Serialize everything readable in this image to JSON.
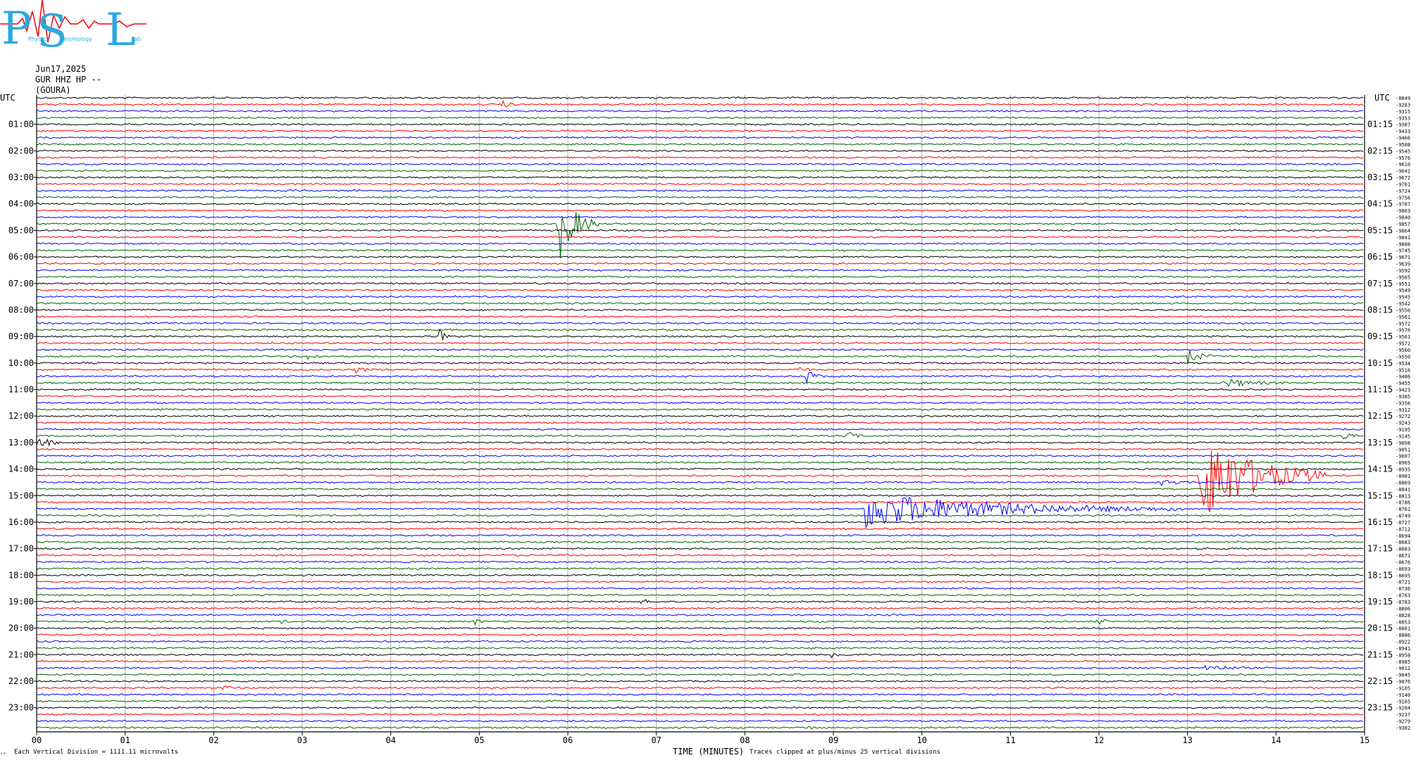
{
  "logo": {
    "big_letters": [
      "P",
      "S",
      "L"
    ],
    "small_words": [
      "Physics",
      "eismology",
      "ab"
    ]
  },
  "header": {
    "date": "Jun17,2025",
    "station": "GUR HHZ HP --",
    "site": "(GOURA)"
  },
  "footer": {
    "mark": "ᵥₐ",
    "left": "Each Vertical Division = 1111.11 microvolts",
    "center": "TIME (MINUTES)",
    "right": "Traces clipped at plus/minus 25 vertical divisions"
  },
  "chart_data": {
    "type": "line",
    "title": "",
    "xlabel": "TIME (MINUTES)",
    "ylabel": "",
    "x_range": [
      0,
      15
    ],
    "x_ticks": [
      "00",
      "01",
      "02",
      "03",
      "04",
      "05",
      "06",
      "07",
      "08",
      "09",
      "10",
      "11",
      "12",
      "13",
      "14",
      "15"
    ],
    "left_axis_title": "UTC",
    "right_axis_title": "UTC",
    "left_labels": [
      "01:00",
      "02:00",
      "03:00",
      "04:00",
      "05:00",
      "06:00",
      "07:00",
      "08:00",
      "09:00",
      "10:00",
      "11:00",
      "12:00",
      "13:00",
      "14:00",
      "15:00",
      "16:00",
      "17:00",
      "18:00",
      "19:00",
      "20:00",
      "21:00",
      "22:00",
      "23:00"
    ],
    "right_labels": [
      "01:15",
      "02:15",
      "03:15",
      "04:15",
      "05:15",
      "06:15",
      "07:15",
      "08:15",
      "09:15",
      "10:15",
      "11:15",
      "12:15",
      "13:15",
      "14:15",
      "15:15",
      "16:15",
      "17:15",
      "18:15",
      "19:15",
      "20:15",
      "21:15",
      "22:15",
      "23:15"
    ],
    "trace_colors": [
      "#000000",
      "#ff0000",
      "#0000ff",
      "#006400"
    ],
    "trace_count": 96,
    "grid": true,
    "trace_offsets": [
      "-8849",
      "-9283",
      "-9315",
      "-9353",
      "-9387",
      "-9433",
      "-9466",
      "-9508",
      "-9545",
      "-9576",
      "-9610",
      "-9642",
      "-9672",
      "-9701",
      "-9724",
      "-9756",
      "-9787",
      "-9803",
      "-9840",
      "-9857",
      "-9864",
      "-9841",
      "-9808",
      "-9745",
      "-9671",
      "-9639",
      "-9592",
      "-9565",
      "-9551",
      "-9549",
      "-9545",
      "-9542",
      "-9556",
      "-9561",
      "-9572",
      "-9576",
      "-9561",
      "-9572",
      "-9560",
      "-9550",
      "-9534",
      "-9516",
      "-9486",
      "-9455",
      "-9423",
      "-9385",
      "-9356",
      "-9312",
      "-9272",
      "-9243",
      "-9195",
      "-9145",
      "-9098",
      "-9051",
      "-9007",
      "-8965",
      "-8935",
      "-8901",
      "-8869",
      "-8841",
      "-8813",
      "-8786",
      "-8761",
      "-8749",
      "-8727",
      "-8712",
      "-8694",
      "-8683",
      "-8683",
      "-8671",
      "-8676",
      "-8693",
      "-8695",
      "-8721",
      "-8736",
      "-8763",
      "-8783",
      "-8806",
      "-8828",
      "-8853",
      "-8801",
      "-8886",
      "-8922",
      "-8941",
      "-8958",
      "-8985",
      "-9012",
      "-9045",
      "-9076",
      "-9105",
      "-9140",
      "-9165",
      "-9204",
      "-9237",
      "-9279",
      "-9302"
    ],
    "events": [
      {
        "trace": 1,
        "minute": 5.25,
        "amp": 6,
        "dur": 0.35
      },
      {
        "trace": 19,
        "minute": 5.9,
        "amp": 55,
        "dur": 0.45
      },
      {
        "trace": 36,
        "minute": 4.55,
        "amp": 12,
        "dur": 0.15
      },
      {
        "trace": 39,
        "minute": 3.05,
        "amp": 6,
        "dur": 0.35
      },
      {
        "trace": 39,
        "minute": 13.0,
        "amp": 12,
        "dur": 0.4
      },
      {
        "trace": 41,
        "minute": 3.6,
        "amp": 5,
        "dur": 0.45
      },
      {
        "trace": 41,
        "minute": 8.6,
        "amp": 6,
        "dur": 0.3
      },
      {
        "trace": 42,
        "minute": 8.7,
        "amp": 10,
        "dur": 0.3
      },
      {
        "trace": 43,
        "minute": 13.4,
        "amp": 7,
        "dur": 1.1
      },
      {
        "trace": 52,
        "minute": 0.0,
        "amp": 9,
        "dur": 0.5
      },
      {
        "trace": 51,
        "minute": 9.15,
        "amp": 8,
        "dur": 0.3
      },
      {
        "trace": 51,
        "minute": 14.75,
        "amp": 8,
        "dur": 0.25
      },
      {
        "trace": 57,
        "minute": 13.15,
        "amp": 75,
        "dur": 1.4
      },
      {
        "trace": 58,
        "minute": 12.7,
        "amp": 5,
        "dur": 0.7
      },
      {
        "trace": 62,
        "minute": 9.35,
        "amp": 28,
        "dur": 3.6
      },
      {
        "trace": 76,
        "minute": 6.85,
        "amp": 8,
        "dur": 0.1
      },
      {
        "trace": 79,
        "minute": 2.75,
        "amp": 9,
        "dur": 0.1
      },
      {
        "trace": 79,
        "minute": 4.95,
        "amp": 7,
        "dur": 0.15
      },
      {
        "trace": 79,
        "minute": 12.0,
        "amp": 7,
        "dur": 0.2
      },
      {
        "trace": 84,
        "minute": 8.95,
        "amp": 7,
        "dur": 0.35
      },
      {
        "trace": 86,
        "minute": 13.2,
        "amp": 5,
        "dur": 1.0
      },
      {
        "trace": 89,
        "minute": 2.1,
        "amp": 4,
        "dur": 0.5
      },
      {
        "trace": 95,
        "minute": 8.7,
        "amp": 4,
        "dur": 0.35
      }
    ]
  }
}
